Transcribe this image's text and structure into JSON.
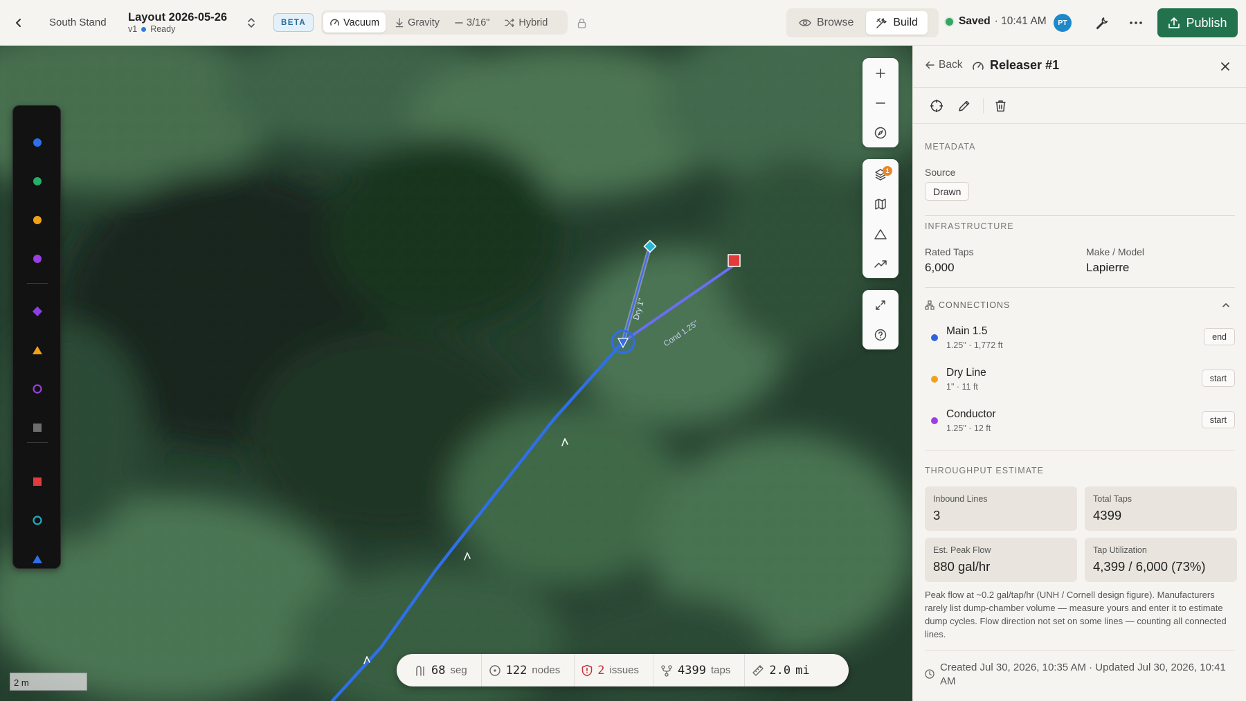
{
  "topbar": {
    "breadcrumb": "South Stand",
    "layout_title": "Layout 2026-05-26",
    "version": "v1",
    "status": "Ready",
    "beta_label": "BETA",
    "modes": [
      {
        "label": "Vacuum",
        "icon": "gauge-icon",
        "active": true
      },
      {
        "label": "Gravity",
        "icon": "arrow-down-icon",
        "active": false
      },
      {
        "label": "3/16\"",
        "icon": "dash-icon",
        "active": false
      },
      {
        "label": "Hybrid",
        "icon": "shuffle-icon",
        "active": false
      }
    ],
    "views": [
      {
        "label": "Browse",
        "icon": "eye-icon",
        "active": false
      },
      {
        "label": "Build",
        "icon": "tools-icon",
        "active": true
      }
    ],
    "saved_label": "Saved",
    "saved_time": "· 10:41 AM",
    "avatar_initials": "PT",
    "publish_label": "Publish",
    "accent_color": "#22724e"
  },
  "map": {
    "scale_label": "2 m",
    "layers_badge": "1",
    "line_labels": {
      "dry": "Dry 1\"",
      "conductor": "Cond 1.25\""
    },
    "stats": [
      {
        "icon": "segment-icon",
        "value": "68",
        "unit": "seg"
      },
      {
        "icon": "node-icon",
        "value": "122",
        "unit": "nodes"
      },
      {
        "icon": "shield-alert-icon",
        "value": "2",
        "unit": "issues",
        "warn": true
      },
      {
        "icon": "tap-icon",
        "value": "4399",
        "unit": "taps"
      },
      {
        "icon": "ruler-icon",
        "value": "2.0",
        "unit": "mi"
      }
    ]
  },
  "panel": {
    "back_label": "Back",
    "title": "Releaser #1",
    "metadata_heading": "METADATA",
    "source_label": "Source",
    "source_value": "Drawn",
    "infrastructure_heading": "INFRASTRUCTURE",
    "rated_taps_label": "Rated Taps",
    "rated_taps_value": "6,000",
    "make_model_label": "Make / Model",
    "make_model_value": "Lapierre",
    "connections_heading": "CONNECTIONS",
    "connections": [
      {
        "name": "Main 1.5",
        "meta": "1.25\" · 1,772 ft",
        "tag": "end",
        "color": "#2f62e0"
      },
      {
        "name": "Dry Line",
        "meta": "1\" · 11 ft",
        "tag": "start",
        "color": "#f0a11c"
      },
      {
        "name": "Conductor",
        "meta": "1.25\" · 12 ft",
        "tag": "start",
        "color": "#9b3fe0"
      }
    ],
    "throughput_heading": "THROUGHPUT ESTIMATE",
    "cards": [
      {
        "label": "Inbound Lines",
        "value": "3"
      },
      {
        "label": "Total Taps",
        "value": "4399"
      },
      {
        "label": "Est. Peak Flow",
        "value": "880 gal/hr"
      },
      {
        "label": "Tap Utilization",
        "value": "4,399 / 6,000 (73%)"
      }
    ],
    "note": "Peak flow at ~0.2 gal/tap/hr (UNH / Cornell design figure). Manufacturers rarely list dump-chamber volume — measure yours and enter it to estimate dump cycles. Flow direction not set on some lines — counting all connected lines.",
    "footer": "Created Jul 30, 2026, 10:35 AM · Updated Jul 30, 2026, 10:41 AM"
  }
}
